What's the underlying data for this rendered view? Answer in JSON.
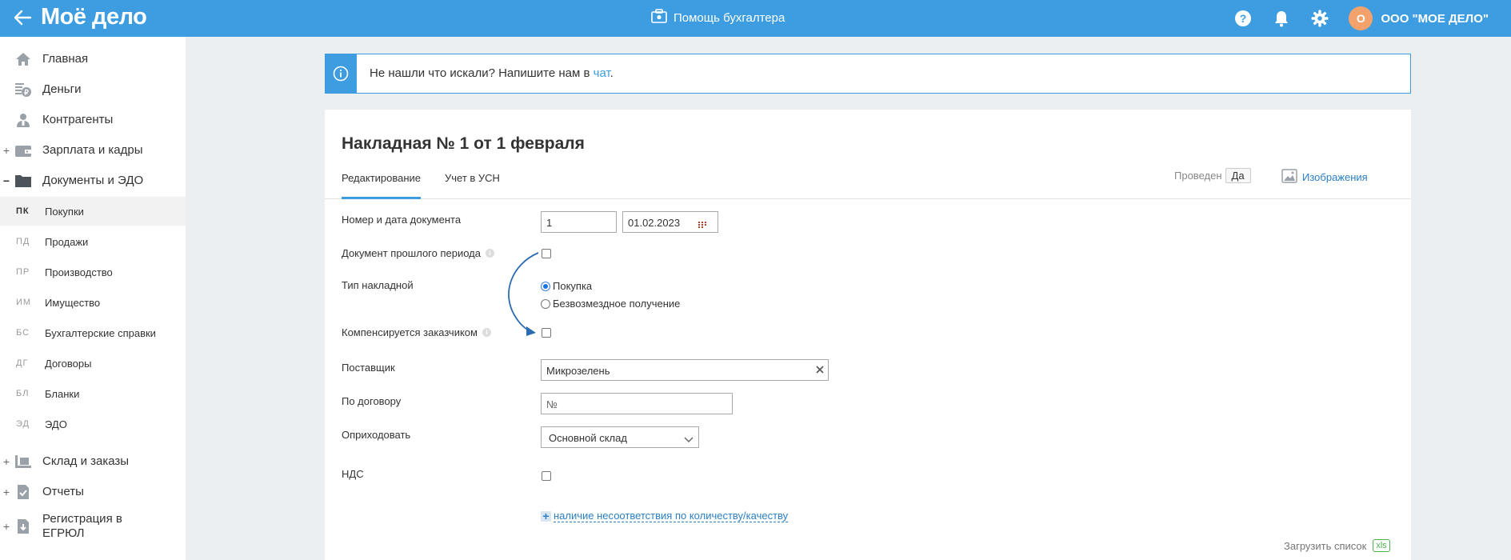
{
  "header": {
    "logo": "Моё дело",
    "center_label": "Помощь бухгалтера",
    "avatar_letter": "О",
    "company": "ООО \"МОЕ ДЕЛО\""
  },
  "sidebar": {
    "main_top": [
      {
        "label": "Главная",
        "expander": ""
      },
      {
        "label": "Деньги",
        "expander": ""
      },
      {
        "label": "Контрагенты",
        "expander": ""
      },
      {
        "label": "Зарплата и кадры",
        "expander": "+"
      },
      {
        "label": "Документы и ЭДО",
        "expander": "−"
      }
    ],
    "sub": [
      {
        "code": "ПК",
        "label": "Покупки"
      },
      {
        "code": "ПД",
        "label": "Продажи"
      },
      {
        "code": "ПР",
        "label": "Производство"
      },
      {
        "code": "ИМ",
        "label": "Имущество"
      },
      {
        "code": "БС",
        "label": "Бухгалтерские справки"
      },
      {
        "code": "ДГ",
        "label": "Договоры"
      },
      {
        "code": "БЛ",
        "label": "Бланки"
      },
      {
        "code": "ЭД",
        "label": "ЭДО"
      }
    ],
    "main_bottom": [
      {
        "label": "Склад и заказы",
        "expander": "+"
      },
      {
        "label": "Отчеты",
        "expander": "+"
      },
      {
        "label": "Регистрация в ЕГРЮЛ",
        "expander": "+"
      }
    ]
  },
  "banner": {
    "text": "Не нашли что искали? Напишите нам в ",
    "link": "чат",
    "end": "."
  },
  "document": {
    "title": "Накладная № 1 от 1 февраля",
    "tabs": [
      "Редактирование",
      "Учет в УСН"
    ],
    "posted_label": "Проведен",
    "posted_value": "Да",
    "images_label": "Изображения"
  },
  "form": {
    "doc_number_label": "Номер и дата документа",
    "doc_number": "1",
    "doc_date": "01.02.2023",
    "past_period_label": "Документ прошлого периода",
    "past_period_checked": false,
    "type_label": "Тип накладной",
    "type_options": [
      "Покупка",
      "Безвозмездное получение"
    ],
    "type_selected": "Покупка",
    "compensated_label": "Компенсируется заказчиком",
    "compensated_checked": false,
    "supplier_label": "Поставщик",
    "supplier_value": "Микрозелень",
    "contract_label": "По договору",
    "contract_placeholder": "№",
    "receive_label": "Оприходовать",
    "receive_value": "Основной склад",
    "vat_label": "НДС",
    "vat_checked": false,
    "mismatch_link": "наличие несоответствия по количеству/качеству",
    "upload_label": "Загрузить список",
    "upload_badge": "xls"
  },
  "colors": {
    "header_bg": "#3d9de0",
    "link": "#2b7fc5",
    "avatar": "#f4a26c",
    "xls": "#4caf50"
  }
}
